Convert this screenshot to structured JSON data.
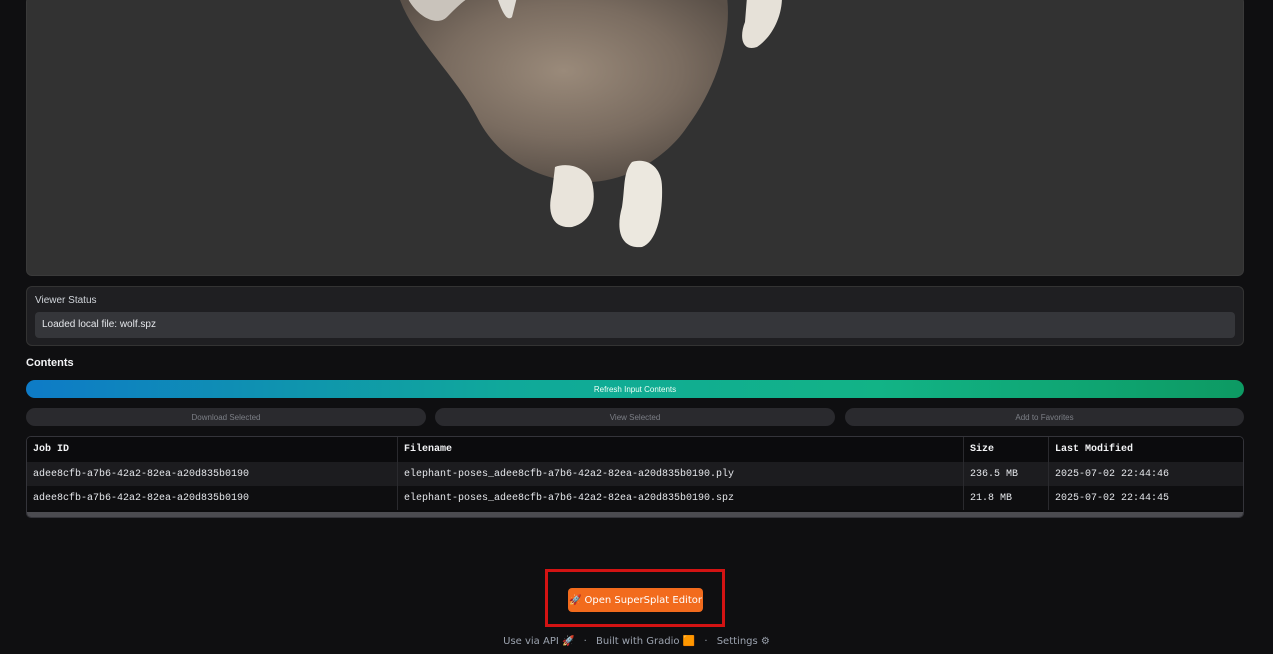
{
  "viewer": {
    "status_label": "Viewer Status",
    "status_value": "Loaded local file: wolf.spz"
  },
  "contents": {
    "title": "Contents",
    "refresh_label": "Refresh Input Contents",
    "download_label": "Download Selected",
    "view_label": "View Selected",
    "favorites_label": "Add to Favorites",
    "columns": [
      "Job ID",
      "Filename",
      "Size",
      "Last Modified"
    ],
    "rows": [
      [
        "adee8cfb-a7b6-42a2-82ea-a20d835b0190",
        "elephant-poses_adee8cfb-a7b6-42a2-82ea-a20d835b0190.ply",
        "236.5 MB",
        "2025-07-02 22:44:46"
      ],
      [
        "adee8cfb-a7b6-42a2-82ea-a20d835b0190",
        "elephant-poses_adee8cfb-a7b6-42a2-82ea-a20d835b0190.spz",
        "21.8 MB",
        "2025-07-02 22:44:45"
      ]
    ]
  },
  "editor": {
    "button_icon": "🚀",
    "button_label": "Open SuperSplat Editor"
  },
  "footer": {
    "api_label": "Use via API",
    "api_icon": "🚀",
    "built_label": "Built with Gradio",
    "built_icon": "🟧",
    "settings_label": "Settings",
    "settings_icon": "⚙"
  },
  "colors": {
    "accent_orange": "#f26b1d",
    "highlight_red": "#d31313",
    "background": "#0f0f11"
  }
}
